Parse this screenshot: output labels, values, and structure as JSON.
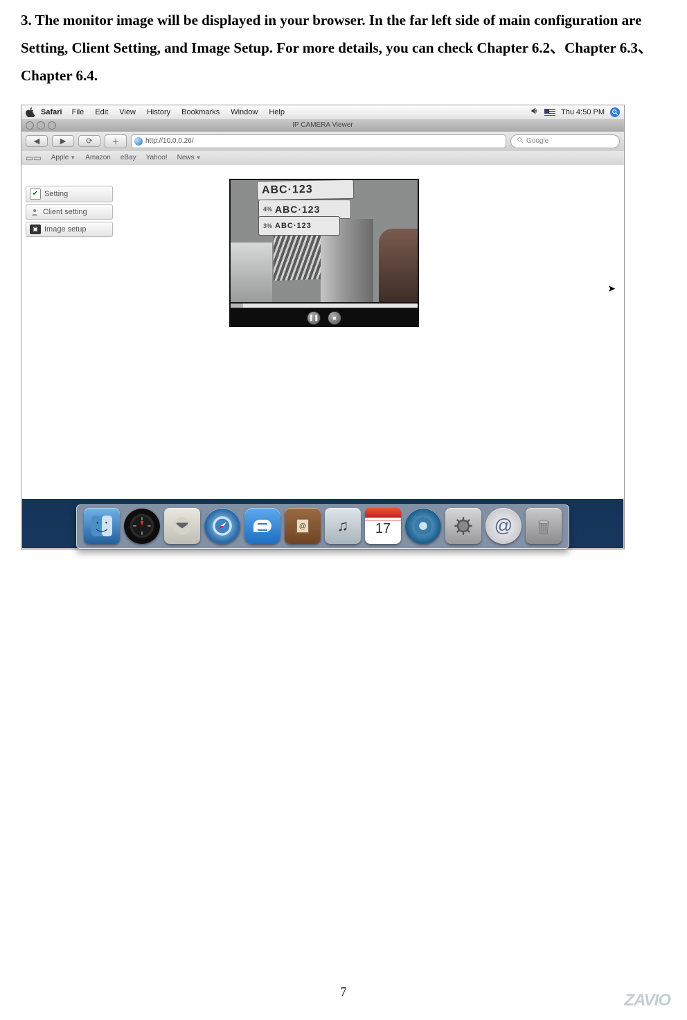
{
  "doc": {
    "paragraph": "3. The monitor image will be displayed in your browser. In the far left side of main configuration are Setting, Client Setting, and Image Setup. For more details, you can check Chapter 6.2、Chapter 6.3、Chapter 6.4.",
    "page_number": "7",
    "footer_logo": "ZAVIO"
  },
  "mac": {
    "menubar": {
      "app": "Safari",
      "items": [
        "File",
        "Edit",
        "View",
        "History",
        "Bookmarks",
        "Window",
        "Help"
      ],
      "clock": "Thu 4:50 PM"
    },
    "window_title": "IP CAMERA Viewer",
    "toolbar": {
      "back": "◀",
      "fwd": "▶",
      "reload": "⟳",
      "add": "＋",
      "url": "http://10.0.0.26/",
      "search_placeholder": "Google"
    },
    "bookmarks": [
      "Apple",
      "Amazon",
      "eBay",
      "Yahoo!",
      "News"
    ],
    "sidebar": [
      {
        "icon": "check",
        "label": "Setting"
      },
      {
        "icon": "user",
        "label": "Client setting"
      },
      {
        "icon": "img",
        "label": "Image setup"
      }
    ],
    "viewer": {
      "plate_top": "ABC·123",
      "plate_mid_pct": "4%",
      "plate_mid": "ABC·123",
      "plate_lo_pct": "3%",
      "plate_lo": "ABC·123",
      "pause": "❚❚",
      "stop": "■"
    },
    "dock": {
      "ical_day": "17",
      "itunes": "♫",
      "at": "@"
    }
  }
}
